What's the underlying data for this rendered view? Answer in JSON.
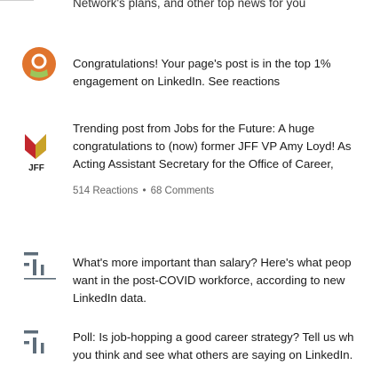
{
  "top_item": {
    "text": "Network's plans, and other top news for you"
  },
  "items": [
    {
      "icon": "pin-icon",
      "text": "Congratulations! Your page's post is in the top 1% engagement on LinkedIn. See reactions"
    },
    {
      "icon": "jff-logo-icon",
      "logo_text": "JFF",
      "text": "Trending post from Jobs for the Future: A huge congratulations to (now) former JFF VP Amy Loyd! As Acting Assistant Secretary for the Office of Career,",
      "reactions": "514 Reactions",
      "comments": "68 Comments"
    },
    {
      "icon": "article-icon",
      "text": "What's more important than salary? Here's what peop want in the post-COVID workforce, according to new LinkedIn data."
    },
    {
      "icon": "article-icon",
      "text": "Poll: Is job-hopping a good career strategy? Tell us wh you think and see what others are saying on LinkedIn."
    }
  ],
  "colors": {
    "pin_orange": "#e0742d",
    "pin_green": "#9cc65a",
    "jff_red": "#c2272d",
    "jff_gold": "#c9a227",
    "icon_gray": "#5e6d7a"
  }
}
